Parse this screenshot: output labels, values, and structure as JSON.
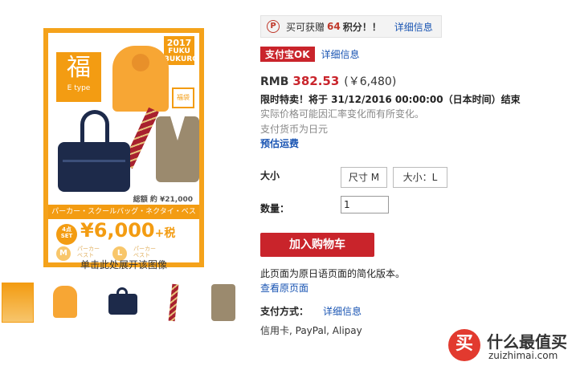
{
  "product_image": {
    "year": "2017",
    "fuku_bukuro": "FUKU BUKURO",
    "fuku_kanji": "福",
    "etype": "E type",
    "lucky_bag": "福袋",
    "total_price": "総額 約 ¥21,000",
    "items_strip": "パーカー・スクールバッグ・ネクタイ・ベスト",
    "set_badge": "4点 SET",
    "big_price": "¥6,000",
    "tax": "+税",
    "size_m": "M",
    "size_l": "L",
    "size_note_m": "パーカー ベスト",
    "size_note_l": "パーカー ベスト",
    "expand_caption": "单击此处展开该图像"
  },
  "thumbnails": [
    "thumb-1",
    "thumb-hoodie",
    "thumb-bag",
    "thumb-tie",
    "thumb-vest"
  ],
  "points": {
    "icon_letter": "P",
    "label": "买可获赠",
    "value": "64",
    "unit": "积分！！",
    "link": "详细信息"
  },
  "alipay": {
    "badge": "支付宝OK",
    "link": "详细信息"
  },
  "price": {
    "currency": "RMB",
    "value": "382.53",
    "jpy": "(￥6,480)"
  },
  "sale": "限时特卖！将于 31/12/2016 00:00:00（日本时间）结束",
  "notes": {
    "rate": "实际价格可能因汇率变化而有所变化。",
    "currency": "支付货币为日元"
  },
  "shipping_link": "预估运费",
  "size": {
    "label": "大小",
    "options": [
      "尺寸 M",
      "大小：L"
    ]
  },
  "quantity": {
    "label": "数量：",
    "value": "1"
  },
  "cart_button": "加入购物车",
  "simplified_note": "此页面为原日语页面的简化版本。",
  "original_link": "查看原页面",
  "payment": {
    "label": "支付方式：",
    "link": "详细信息",
    "methods": "信用卡, PayPal, Alipay"
  },
  "watermark": {
    "logo_char": "买",
    "title": "什么最值买",
    "url": "zuizhimai.com"
  }
}
